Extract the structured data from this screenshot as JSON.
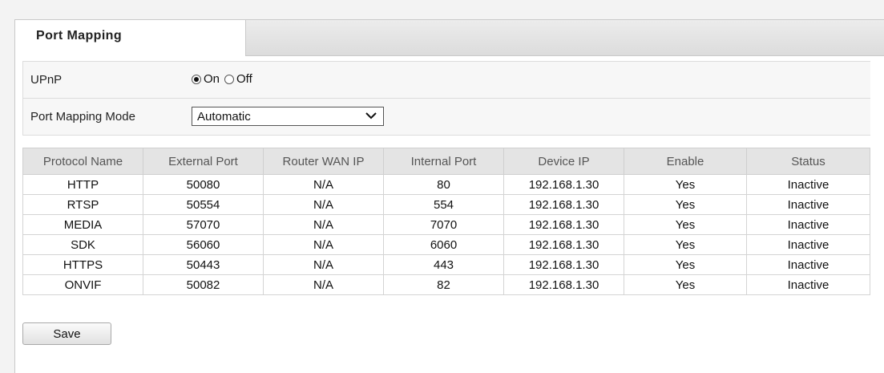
{
  "tab": {
    "active_label": "Port Mapping"
  },
  "upnp": {
    "label": "UPnP",
    "options": [
      {
        "label": "On",
        "checked": true
      },
      {
        "label": "Off",
        "checked": false
      }
    ]
  },
  "mode": {
    "label": "Port Mapping Mode",
    "selected": "Automatic"
  },
  "table": {
    "headers": [
      "Protocol Name",
      "External Port",
      "Router WAN IP",
      "Internal Port",
      "Device IP",
      "Enable",
      "Status"
    ],
    "rows": [
      [
        "HTTP",
        "50080",
        "N/A",
        "80",
        "192.168.1.30",
        "Yes",
        "Inactive"
      ],
      [
        "RTSP",
        "50554",
        "N/A",
        "554",
        "192.168.1.30",
        "Yes",
        "Inactive"
      ],
      [
        "MEDIA",
        "57070",
        "N/A",
        "7070",
        "192.168.1.30",
        "Yes",
        "Inactive"
      ],
      [
        "SDK",
        "56060",
        "N/A",
        "6060",
        "192.168.1.30",
        "Yes",
        "Inactive"
      ],
      [
        "HTTPS",
        "50443",
        "N/A",
        "443",
        "192.168.1.30",
        "Yes",
        "Inactive"
      ],
      [
        "ONVIF",
        "50082",
        "N/A",
        "82",
        "192.168.1.30",
        "Yes",
        "Inactive"
      ]
    ]
  },
  "actions": {
    "save_label": "Save"
  },
  "icons": {
    "dropdown": "chevron-down-icon",
    "radio": "radio-button-icon"
  }
}
